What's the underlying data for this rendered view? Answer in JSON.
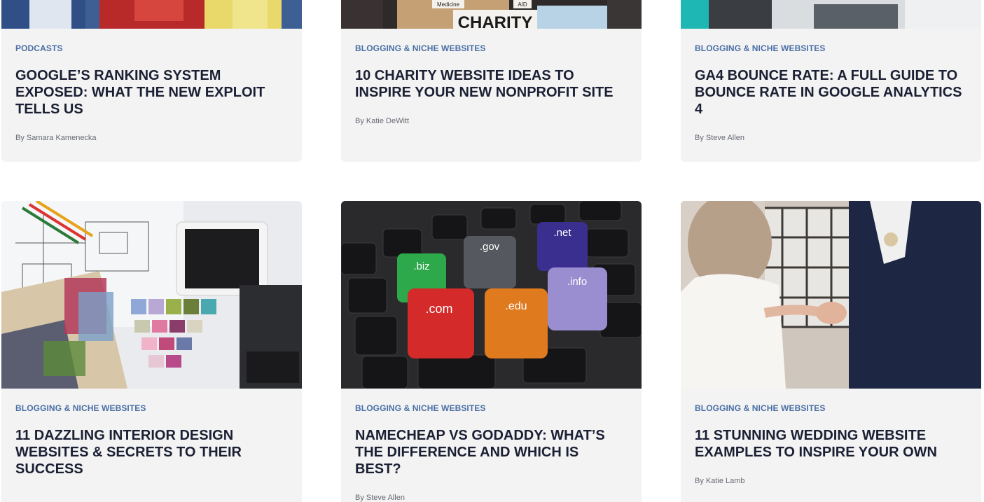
{
  "posts": [
    {
      "category": "PODCASTS",
      "title": "GOOGLE’S RANKING SYSTEM EXPOSED: WHAT THE NEW EXPLOIT TELLS US",
      "author": "By Samara Kamenecka",
      "image": "podcast-hosts-photo"
    },
    {
      "category": "BLOGGING & NICHE WEBSITES",
      "title": "10 CHARITY WEBSITE IDEAS TO INSPIRE YOUR NEW NONPROFIT SITE",
      "author": "By Katie DeWitt",
      "image": "charity-boxes-photo",
      "image_text": [
        "Medicine",
        "AID",
        "CHARITY"
      ]
    },
    {
      "category": "BLOGGING & NICHE WEBSITES",
      "title": "GA4 BOUNCE RATE: A FULL GUIDE TO BOUNCE RATE IN GOOGLE ANALYTICS 4",
      "author": "By Steve Allen",
      "image": "desk-monitor-photo"
    },
    {
      "category": "BLOGGING & NICHE WEBSITES",
      "title": "11 DAZZLING INTERIOR DESIGN WEBSITES & SECRETS TO THEIR SUCCESS",
      "author": "",
      "image": "interior-design-swatches-photo"
    },
    {
      "category": "BLOGGING & NICHE WEBSITES",
      "title": "NAMECHEAP VS GODADDY: WHAT’S THE DIFFERENCE AND WHICH IS BEST?",
      "author": "By Steve Allen",
      "image": "domain-dice-keyboard-photo",
      "image_text": [
        ".biz",
        ".gov",
        ".net",
        ".com",
        ".edu",
        ".info"
      ]
    },
    {
      "category": "BLOGGING & NICHE WEBSITES",
      "title": "11 STUNNING WEDDING WEBSITE EXAMPLES TO INSPIRE YOUR OWN",
      "author": "By Katie Lamb",
      "image": "wedding-couple-photo"
    }
  ],
  "colors": {
    "category": "#4a6fa5",
    "title": "#1b1f33",
    "card_bg": "#f3f3f3",
    "author": "#666a74"
  }
}
